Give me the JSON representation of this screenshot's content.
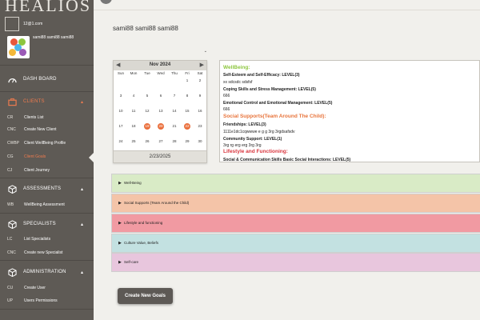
{
  "app": {
    "logo": "HEALIOS"
  },
  "user": {
    "email": "12@1.com",
    "name": "sami88 sami88 sami88"
  },
  "nav": {
    "dashboard": "DASH BOARD",
    "clients": "CLIENTS",
    "clients_items": [
      {
        "abbr": "CR",
        "label": "Clients List"
      },
      {
        "abbr": "CNC",
        "label": "Create New Client"
      },
      {
        "abbr": "CWBP",
        "label": "Client WellBeing Profile"
      },
      {
        "abbr": "CG",
        "label": "Client Goals"
      },
      {
        "abbr": "CJ",
        "label": "Client Journey"
      }
    ],
    "assessments": "ASSESSMENTS",
    "assessments_items": [
      {
        "abbr": "WB",
        "label": "WellBeing Assessment"
      }
    ],
    "specialists": "SPECIALISTS",
    "specialists_items": [
      {
        "abbr": "LC",
        "label": "List Specialists"
      },
      {
        "abbr": "CNC",
        "label": "Create new Specialist"
      }
    ],
    "administration": "ADMINISTRATION",
    "administration_items": [
      {
        "abbr": "CU",
        "label": "Create User"
      },
      {
        "abbr": "UP",
        "label": "Users Permissions"
      }
    ]
  },
  "main": {
    "page_title": "sami88 sami88 sami88",
    "dropdown_value": ""
  },
  "calendar": {
    "month_label": "Nov 2024",
    "prev": "◀",
    "next": "▶",
    "dows": [
      "Sun",
      "Mon",
      "Tue",
      "Wed",
      "Thu",
      "Fri",
      "Sat"
    ],
    "weeks": [
      [
        "",
        "",
        "",
        "",
        "",
        "1",
        "2"
      ],
      [
        "3",
        "4",
        "5",
        "6",
        "7",
        "8",
        "9"
      ],
      [
        "10",
        "11",
        "12",
        "13",
        "14",
        "15",
        "16"
      ],
      [
        "17",
        "18",
        "19",
        "20",
        "21",
        "22",
        "23"
      ],
      [
        "24",
        "25",
        "26",
        "27",
        "28",
        "29",
        "30"
      ]
    ],
    "highlighted": [
      "19",
      "20",
      "22"
    ],
    "selected_date": "2/23/2025"
  },
  "summary": {
    "wellbeing_title": "WellBeing:",
    "wellbeing_color": "#8dc63f",
    "l1": "Self-Esteem and Self-Efficacy: LEVEL(3)",
    "l2": "xx sdcsdc sdsfsf",
    "l3": "Coping Skills and Stress Management: LEVEL(5)",
    "l4": "666",
    "l5": "Emotional Control and Emotional Management: LEVEL(5)",
    "l6": "666",
    "social_title": "Social Supports(Team Around The Child):",
    "social_color": "#e8743b",
    "l7": "Friendships: LEVEL(3)",
    "l8": "1111e1dc1cqwwwe e g g 3rg 3rgdsafsdv",
    "l9": "Community Support: LEVEL(1)",
    "l10": "3rg rg erg erg 3rg 3rg",
    "lifestyle_title": "Lifestyle and Functioning:",
    "lifestyle_color": "#d9363e",
    "l11": "Social & Communication Skills Basic Social Interactions: LEVEL(5)"
  },
  "accordions": [
    {
      "label": "Well-Being",
      "color": "#d9ebc6"
    },
    {
      "label": "Social Supports (Team Around the Child)",
      "color": "#f4c4a8"
    },
    {
      "label": "Lifestyle and functioning",
      "color": "#f19aa2"
    },
    {
      "label": "Culture Value, Beliefs",
      "color": "#c3e1e1"
    },
    {
      "label": "Self-care",
      "color": "#e8c6dd"
    }
  ],
  "buttons": {
    "create_goals": "Create New Goals"
  }
}
